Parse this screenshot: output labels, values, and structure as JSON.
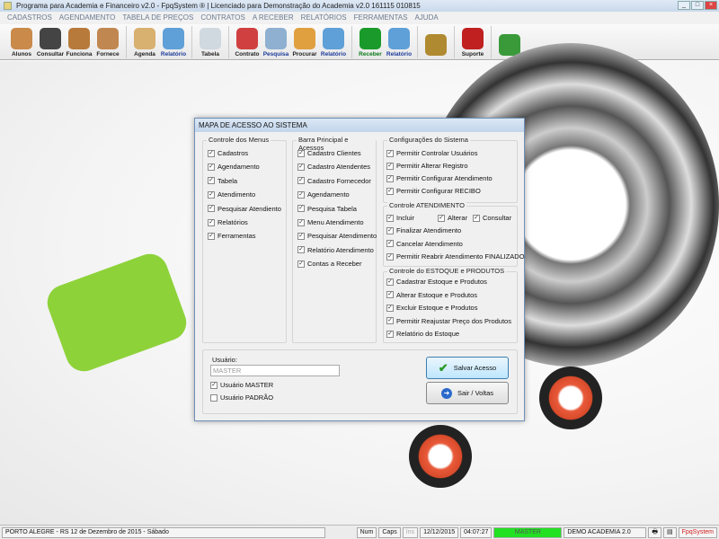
{
  "window": {
    "title": "Programa para Academia e Financeiro v2.0 - FpqSystem ® | Licenciado para  Demonstração do Academia v2.0 161115 010815"
  },
  "menu": [
    "CADASTROS",
    "AGENDAMENTO",
    "TABELA DE PREÇOS",
    "CONTRATOS",
    "A RECEBER",
    "RELATÓRIOS",
    "FERRAMENTAS",
    "AJUDA"
  ],
  "toolbar": [
    {
      "label": "Alunos",
      "icon": "students-icon",
      "color": "#c98a4a",
      "style": ""
    },
    {
      "label": "Consultar",
      "icon": "id-card-icon",
      "color": "#444444",
      "style": ""
    },
    {
      "label": "Funciona",
      "icon": "employees-icon",
      "color": "#b87a3a",
      "style": ""
    },
    {
      "label": "Fornece",
      "icon": "supplier-icon",
      "color": "#c08850",
      "style": ""
    },
    {
      "sep": true
    },
    {
      "label": "Agenda",
      "icon": "calendar-clock-icon",
      "color": "#d8b070",
      "style": ""
    },
    {
      "label": "Relatório",
      "icon": "printer-icon",
      "color": "#5fa0d8",
      "style": "b"
    },
    {
      "sep": true
    },
    {
      "label": "Tabela",
      "icon": "document-icon",
      "color": "#d0d8e0",
      "style": ""
    },
    {
      "sep": true
    },
    {
      "label": "Contrato",
      "icon": "pen-icon",
      "color": "#d04040",
      "style": ""
    },
    {
      "label": "Pesquisa",
      "icon": "search-docs-icon",
      "color": "#8fb0d0",
      "style": "b"
    },
    {
      "label": "Procurar",
      "icon": "folder-icon",
      "color": "#e0a040",
      "style": ""
    },
    {
      "label": "Relatório",
      "icon": "printer-icon",
      "color": "#5fa0d8",
      "style": "b"
    },
    {
      "sep": true
    },
    {
      "label": "Receber",
      "icon": "dollar-icon",
      "color": "#1a9a2a",
      "style": "g"
    },
    {
      "label": "Relatório",
      "icon": "printer-icon",
      "color": "#5fa0d8",
      "style": "b"
    },
    {
      "sep": true
    },
    {
      "label": "",
      "icon": "coin-icon",
      "color": "#b08a30",
      "style": ""
    },
    {
      "sep": true
    },
    {
      "label": "Suporte",
      "icon": "support-icon",
      "color": "#c02020",
      "style": ""
    },
    {
      "sep": true
    },
    {
      "label": "",
      "icon": "exit-icon",
      "color": "#3a9a3a",
      "style": ""
    }
  ],
  "dialog": {
    "title": "MAPA DE ACESSO AO SISTEMA",
    "groups": {
      "menus": {
        "title": "Controle dos Menus",
        "items": [
          "Cadastros",
          "Agendamento",
          "Tabela",
          "Atendimento",
          "Pesquisar Atendiento",
          "Relatórios",
          "Ferramentas"
        ]
      },
      "barra": {
        "title": "Barra Principal e Acessos",
        "items": [
          "Cadastro Clientes",
          "Cadastro Atendentes",
          "Cadastro Fornecedor",
          "Agendamento",
          "Pesquisa Tabela",
          "Menu Atendimento",
          "Pesquisar Atendimento",
          "Relatório Atendimento",
          "Contas a Receber"
        ]
      },
      "config": {
        "title": "Configurações do Sistema",
        "items": [
          "Permitir Controlar Usuários",
          "Permitir Alterar Registro",
          "Permitir Configurar Atendimento",
          "Permitir Configurar RECIBO"
        ]
      },
      "atend": {
        "title": "Controle ATENDIMENTO",
        "inline": [
          "Incluir",
          "Alterar",
          "Consultar"
        ],
        "items": [
          "Finalizar Atendimento",
          "Cancelar Atendimento",
          "Permitir Reabrir Atendimento FINALIZADO"
        ]
      },
      "estoque": {
        "title": "Controle do ESTOQUE e PRODUTOS",
        "items": [
          "Cadastrar Estoque e Produtos",
          "Alterar Estoque e Produtos",
          "Excluir Estoque e Produtos",
          "Permitir Reajustar Preço dos Produtos",
          "Relatório do Estoque"
        ]
      }
    },
    "user_label": "Usuário:",
    "user_value": "MASTER",
    "master_label": "Usuário MASTER",
    "master_checked": true,
    "padrao_label": "Usuário PADRÃO",
    "padrao_checked": false,
    "save_label": "Salvar Acesso",
    "exit_label": "Sair / Voltas"
  },
  "status": {
    "location": "PORTO ALEGRE - RS 12 de Dezembro de 2015 - Sábado",
    "num": "Num",
    "caps": "Caps",
    "ins": "Ins",
    "date": "12/12/2015",
    "time": "04:07:27",
    "user": "MASTER",
    "company": "DEMO ACADEMIA 2.0",
    "brand": "FpqSystem"
  }
}
